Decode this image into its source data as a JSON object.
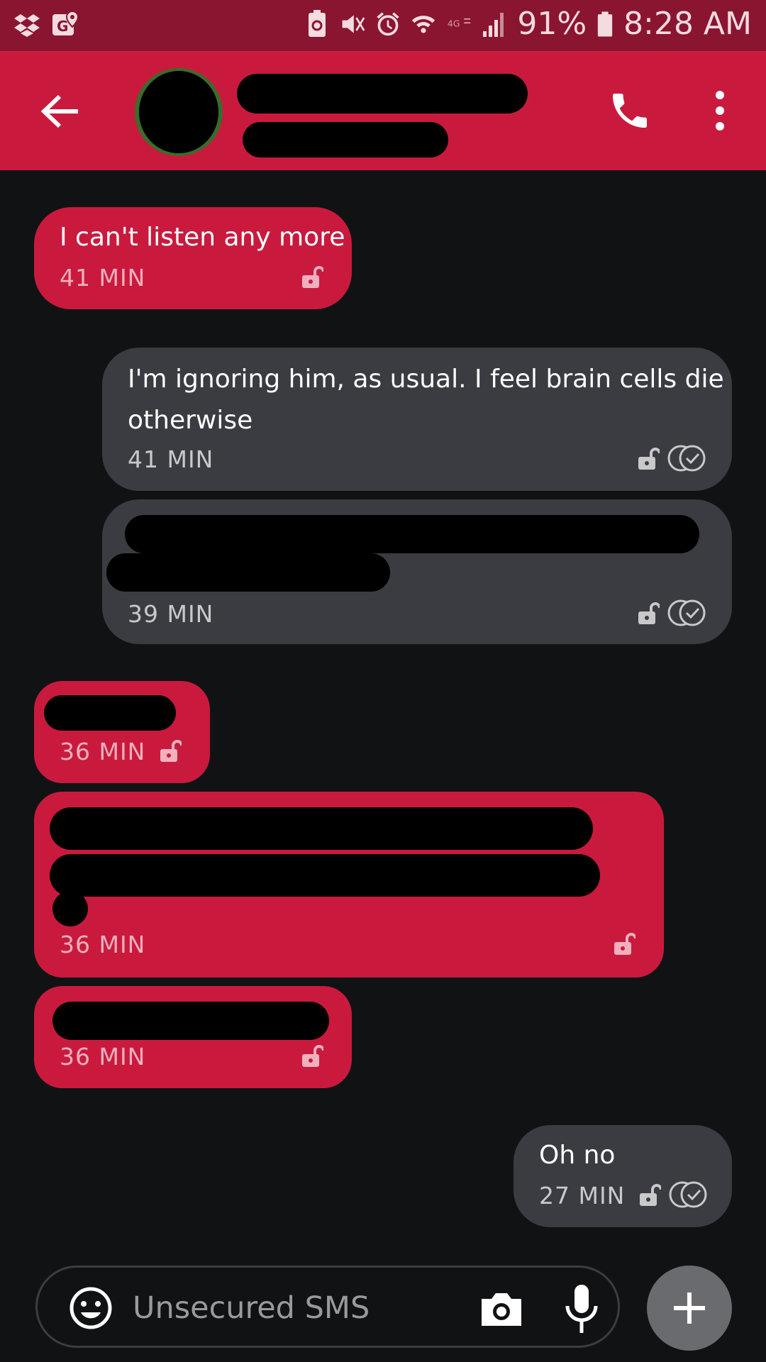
{
  "status_bar": {
    "battery": "91%",
    "time": "8:28 AM",
    "icons": [
      "dropbox-icon",
      "maps-icon",
      "battery-saver-icon",
      "mute-icon",
      "alarm-icon",
      "wifi-icon",
      "lte-icon",
      "signal-icon",
      "battery-icon"
    ]
  },
  "header": {
    "icons": [
      "back-arrow-icon",
      "phone-icon",
      "more-vert-icon"
    ]
  },
  "messages": [
    {
      "direction": "in",
      "text": "I can't listen any more",
      "time": "41 MIN"
    },
    {
      "direction": "out",
      "text_lines": [
        "I'm ignoring him, as usual. I feel brain cells die",
        "otherwise"
      ],
      "time": "41 MIN"
    },
    {
      "direction": "out",
      "text": "",
      "time": "39 MIN"
    },
    {
      "direction": "in",
      "text": "",
      "time": "36 MIN"
    },
    {
      "direction": "in",
      "text": "",
      "time": "36 MIN"
    },
    {
      "direction": "in",
      "text": "",
      "time": "36 MIN"
    },
    {
      "direction": "out",
      "text": "Oh no",
      "time": "27 MIN"
    }
  ],
  "composer": {
    "placeholder": "Unsecured SMS",
    "icons": [
      "emoji-icon",
      "camera-icon",
      "microphone-icon",
      "plus-icon"
    ]
  },
  "colors": {
    "accent": "#c91a3e",
    "status_bar": "#8a1530",
    "background": "#111214",
    "outgoing_bubble": "#3b3c41"
  }
}
